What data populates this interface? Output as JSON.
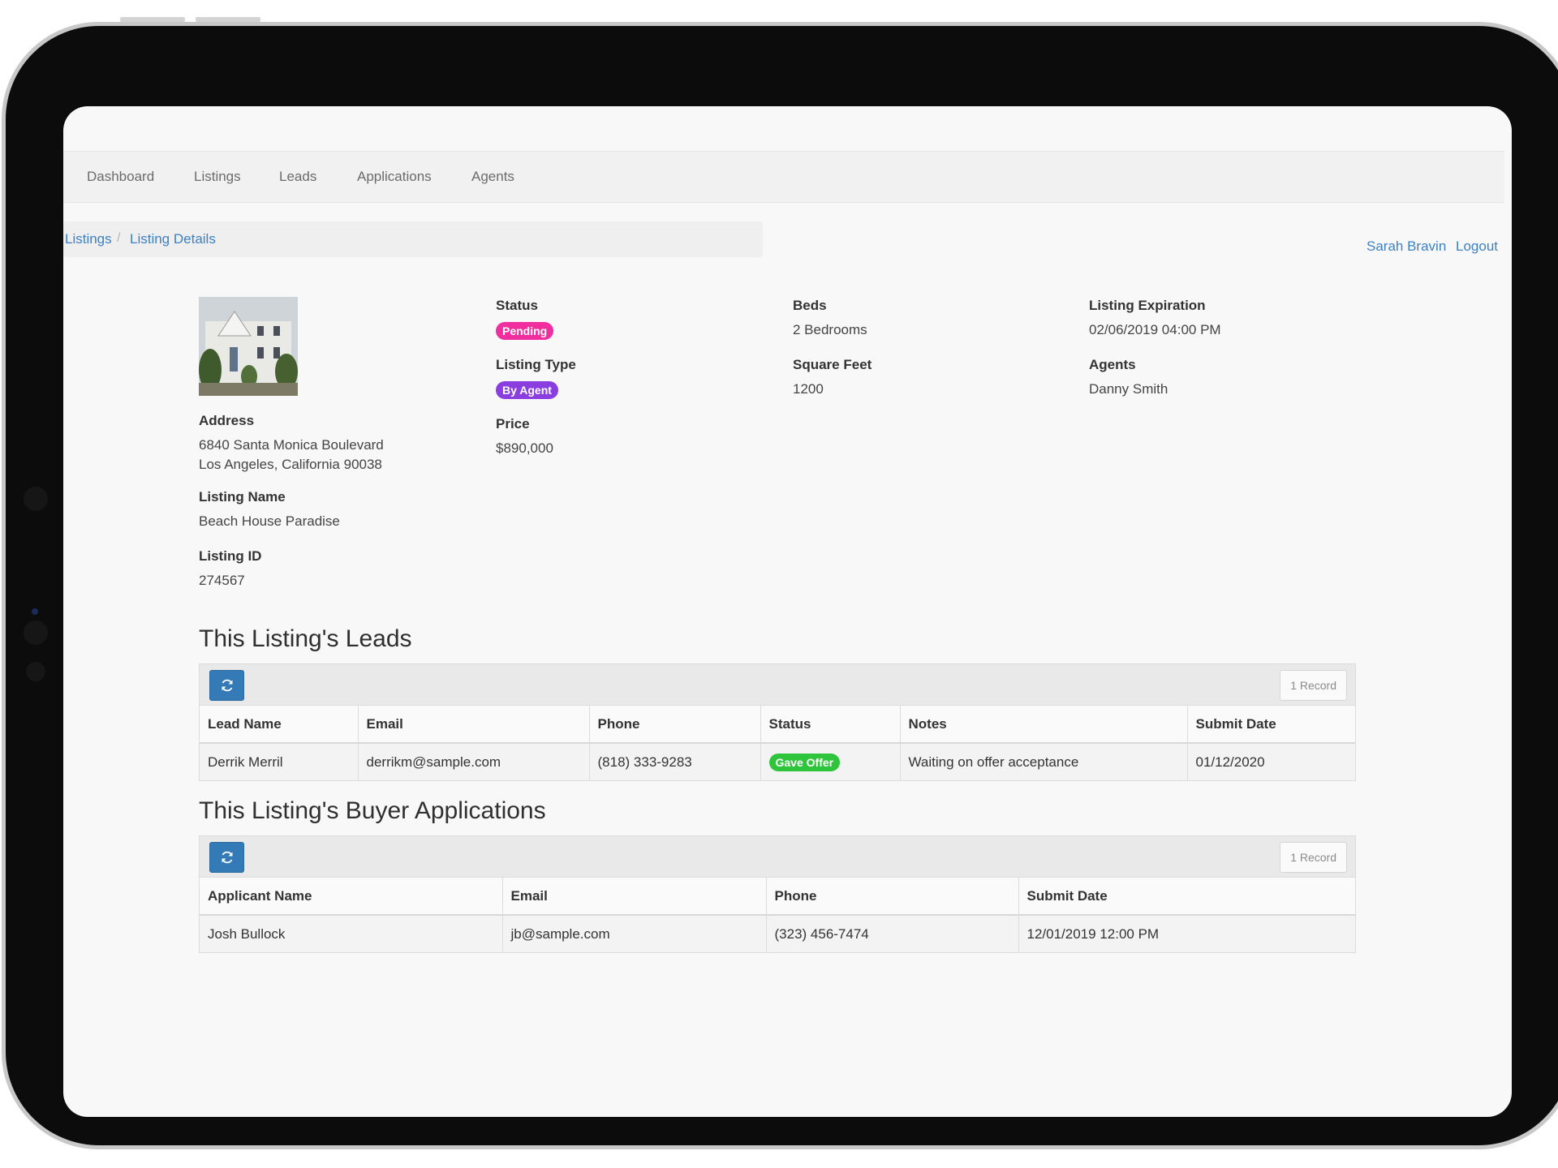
{
  "nav": {
    "items": [
      "Dashboard",
      "Listings",
      "Leads",
      "Applications",
      "Agents"
    ]
  },
  "breadcrumb": {
    "items": [
      "Listings",
      "Listing Details"
    ],
    "separator": "/"
  },
  "user": {
    "name": "Sarah Bravin",
    "logout": "Logout"
  },
  "listing": {
    "photo_icon": "house-photo",
    "address_label": "Address",
    "address_line1": "6840 Santa Monica Boulevard",
    "address_line2": "Los Angeles, California 90038",
    "name_label": "Listing Name",
    "name": "Beach House Paradise",
    "id_label": "Listing ID",
    "id": "274567",
    "status_label": "Status",
    "status": "Pending",
    "status_color": "#f02e9e",
    "type_label": "Listing Type",
    "type": "By Agent",
    "type_color": "#8a3ee0",
    "price_label": "Price",
    "price": "$890,000",
    "beds_label": "Beds",
    "beds": "2 Bedrooms",
    "sqft_label": "Square Feet",
    "sqft": "1200",
    "expiration_label": "Listing Expiration",
    "expiration": "02/06/2019 04:00 PM",
    "agents_label": "Agents",
    "agents": "Danny Smith"
  },
  "leads": {
    "title": "This Listing's Leads",
    "record_count": "1 Record",
    "refresh_icon": "refresh-icon",
    "columns": [
      "Lead Name",
      "Email",
      "Phone",
      "Status",
      "Notes",
      "Submit Date"
    ],
    "rows": [
      {
        "name": "Derrik Merril",
        "email": "derrikm@sample.com",
        "phone": "(818) 333-9283",
        "status": "Gave Offer",
        "status_color": "#2ec43b",
        "notes": "Waiting on offer acceptance",
        "submit_date": "01/12/2020"
      }
    ]
  },
  "applications": {
    "title": "This Listing's Buyer Applications",
    "record_count": "1 Record",
    "refresh_icon": "refresh-icon",
    "columns": [
      "Applicant Name",
      "Email",
      "Phone",
      "Submit Date"
    ],
    "rows": [
      {
        "name": "Josh Bullock",
        "email": "jb@sample.com",
        "phone": "(323) 456-7474",
        "submit_date": "12/01/2019 12:00 PM"
      }
    ]
  }
}
